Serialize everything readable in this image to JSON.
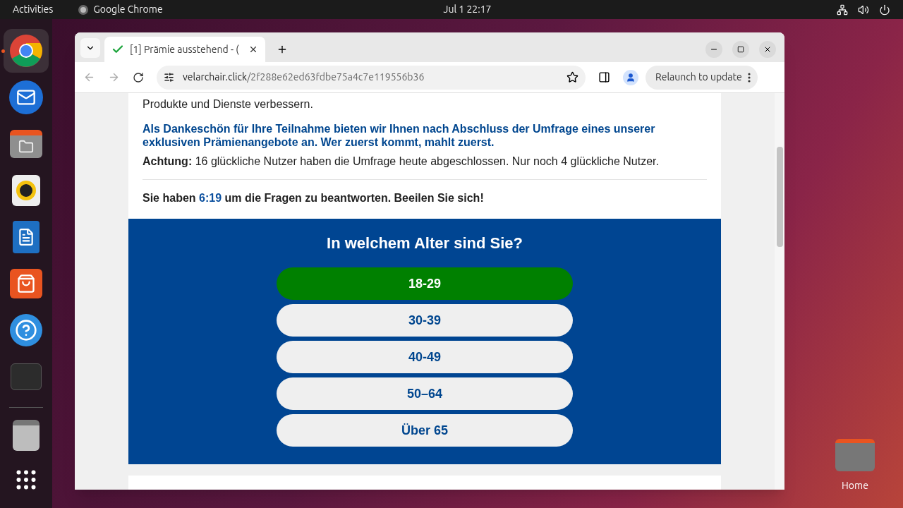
{
  "top_bar": {
    "activities": "Activities",
    "app_name": "Google Chrome",
    "clock": "Jul 1  22:17"
  },
  "dock": {
    "items": [
      {
        "kind": "chrome",
        "selected": true
      },
      {
        "kind": "mail",
        "selected": false
      },
      {
        "kind": "files",
        "selected": false
      },
      {
        "kind": "music",
        "selected": false
      },
      {
        "kind": "writer",
        "selected": false
      },
      {
        "kind": "store",
        "selected": false
      },
      {
        "kind": "help",
        "selected": false
      },
      {
        "kind": "terminal",
        "selected": false
      },
      {
        "kind": "trash",
        "selected": false
      }
    ]
  },
  "browser": {
    "tab_title": "[1] Prämie ausstehend - (",
    "url_domain": "velarchair.click",
    "url_path": "/2f288e62ed63fdbe75a4c7e119556b36",
    "relaunch": "Relaunch to update"
  },
  "page": {
    "intro": "Produkte und Dienste verbessern.",
    "offer": "Als Dankeschön für Ihre Teilnahme bieten wir Ihnen nach Abschluss der Umfrage eines unserer exklusiven Prämienangebote an. Wer zuerst kommt, mahlt zuerst.",
    "notice": "**Achtung:** 16 glückliche Nutzer haben die Umfrage heute abgeschlossen. Nur noch 4 glückliche Nutzer.",
    "timer_before": "Sie haben",
    "timer": "6:19",
    "timer_after": "um die Fragen zu beantworten. Beeilen Sie sich!",
    "question": "In welchem Alter sind Sie?",
    "options": [
      {
        "label": "18-29",
        "selected": true
      },
      {
        "label": "30-39",
        "selected": false
      },
      {
        "label": "40-49",
        "selected": false
      },
      {
        "label": "50–64",
        "selected": false
      },
      {
        "label": "Über 65",
        "selected": false
      }
    ]
  },
  "desktop_icons": [
    {
      "label": "Home"
    }
  ]
}
